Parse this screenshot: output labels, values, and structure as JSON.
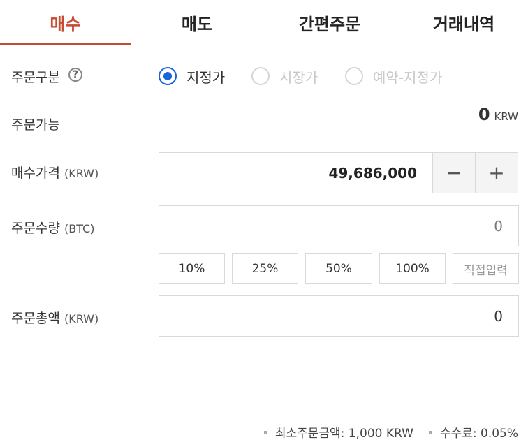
{
  "tabs": [
    {
      "label": "매수",
      "active": true
    },
    {
      "label": "매도",
      "active": false
    },
    {
      "label": "간편주문",
      "active": false
    },
    {
      "label": "거래내역",
      "active": false
    }
  ],
  "order_type": {
    "label": "주문구분",
    "help": "?",
    "options": [
      {
        "label": "지정가",
        "selected": true,
        "enabled": true
      },
      {
        "label": "시장가",
        "selected": false,
        "enabled": false
      },
      {
        "label": "예약-지정가",
        "selected": false,
        "enabled": false
      }
    ]
  },
  "available": {
    "label": "주문가능",
    "value": "0",
    "unit": "KRW"
  },
  "price": {
    "label": "매수가격",
    "unit": "(KRW)",
    "value": "49,686,000",
    "minus": "−",
    "plus": "+"
  },
  "quantity": {
    "label": "주문수량",
    "unit": "(BTC)",
    "value": "0",
    "percent_buttons": [
      "10%",
      "25%",
      "50%",
      "100%"
    ],
    "direct_input": "직접입력"
  },
  "total": {
    "label": "주문총액",
    "unit": "(KRW)",
    "value": "0"
  },
  "footer": {
    "min_order": "최소주문금액: 1,000 KRW",
    "fee": "수수료: 0.05%"
  },
  "colors": {
    "accent": "#c84a31",
    "radio_selected": "#1a63d8"
  }
}
